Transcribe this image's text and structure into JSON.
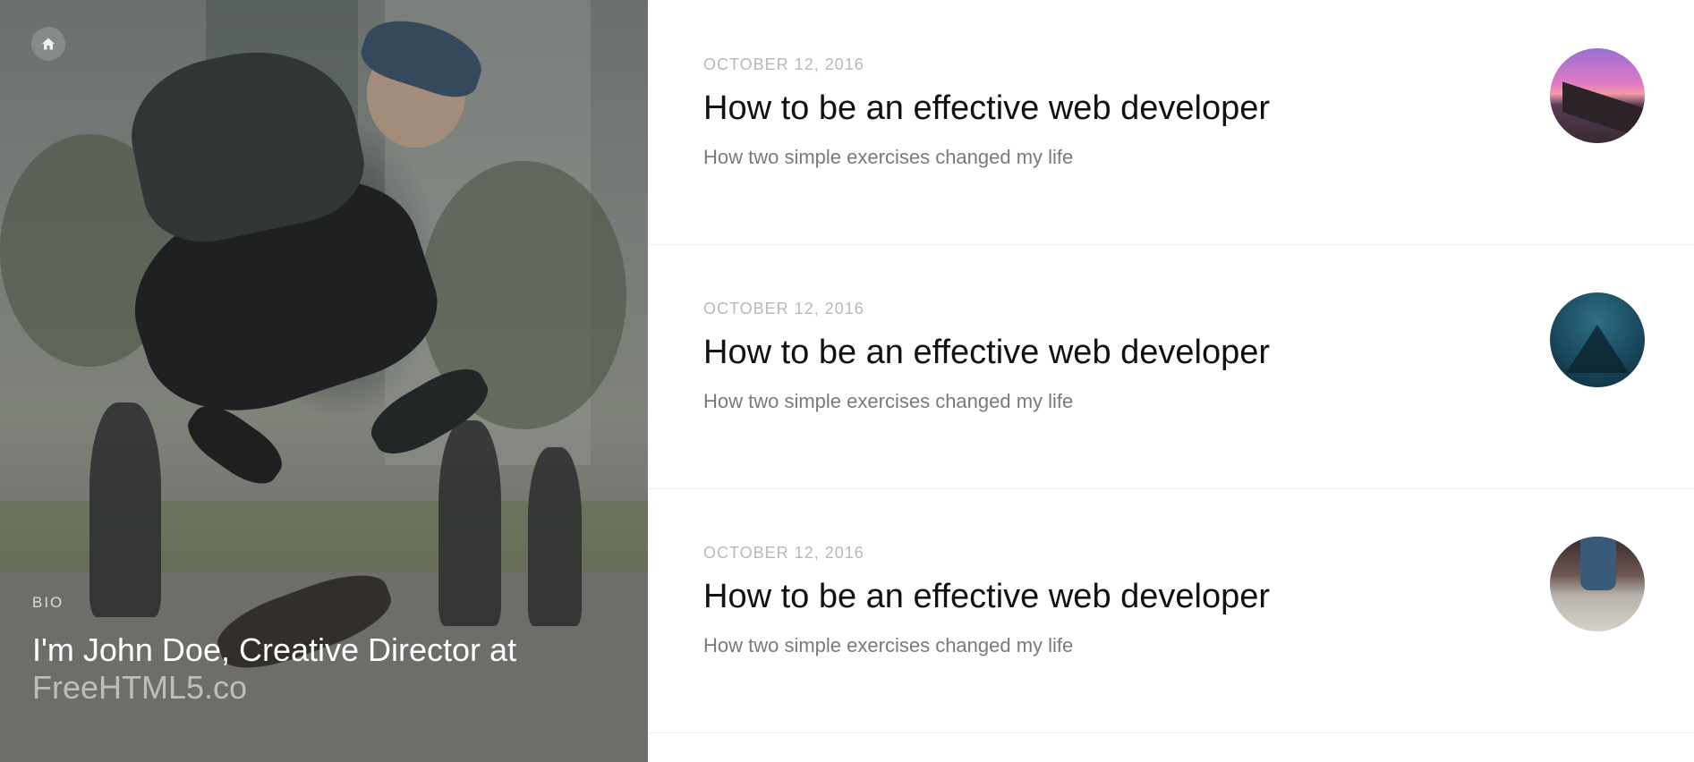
{
  "hero": {
    "home_icon": "home-icon",
    "bio_label": "BIO",
    "bio_title_main": "I'm John Doe, Creative Director at",
    "bio_title_link": "FreeHTML5.co"
  },
  "posts": [
    {
      "date": "OCTOBER 12, 2016",
      "title": "How to be an effective web developer",
      "subtitle": "How two simple exercises changed my life"
    },
    {
      "date": "OCTOBER 12, 2016",
      "title": "How to be an effective web developer",
      "subtitle": "How two simple exercises changed my life"
    },
    {
      "date": "OCTOBER 12, 2016",
      "title": "How to be an effective web developer",
      "subtitle": "How two simple exercises changed my life"
    }
  ]
}
